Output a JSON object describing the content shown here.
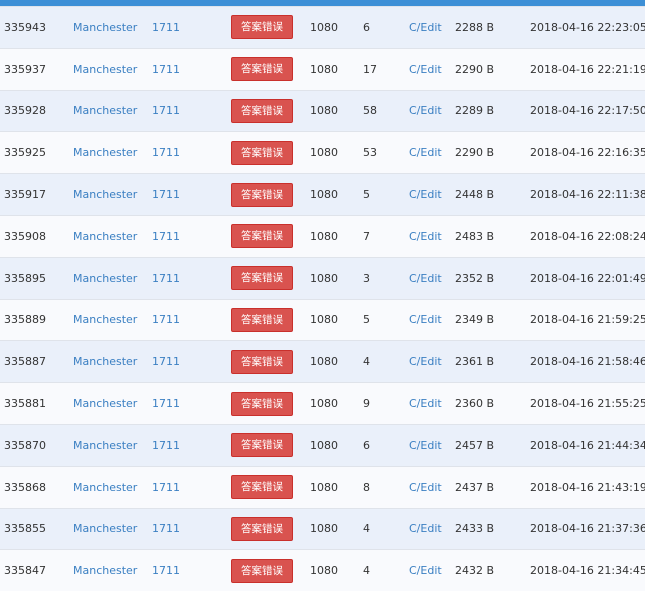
{
  "status_color": "#d9534f",
  "link_color": "#3a7fc2",
  "rows": [
    {
      "id": "335943",
      "user": "Manchester",
      "problem": "1711",
      "status": "答案错误",
      "memory": "1080",
      "time": "6",
      "lang": "C/Edit",
      "length": "2288 B",
      "submitted": "2018-04-16 22:23:05"
    },
    {
      "id": "335937",
      "user": "Manchester",
      "problem": "1711",
      "status": "答案错误",
      "memory": "1080",
      "time": "17",
      "lang": "C/Edit",
      "length": "2290 B",
      "submitted": "2018-04-16 22:21:19"
    },
    {
      "id": "335928",
      "user": "Manchester",
      "problem": "1711",
      "status": "答案错误",
      "memory": "1080",
      "time": "58",
      "lang": "C/Edit",
      "length": "2289 B",
      "submitted": "2018-04-16 22:17:50"
    },
    {
      "id": "335925",
      "user": "Manchester",
      "problem": "1711",
      "status": "答案错误",
      "memory": "1080",
      "time": "53",
      "lang": "C/Edit",
      "length": "2290 B",
      "submitted": "2018-04-16 22:16:35"
    },
    {
      "id": "335917",
      "user": "Manchester",
      "problem": "1711",
      "status": "答案错误",
      "memory": "1080",
      "time": "5",
      "lang": "C/Edit",
      "length": "2448 B",
      "submitted": "2018-04-16 22:11:38"
    },
    {
      "id": "335908",
      "user": "Manchester",
      "problem": "1711",
      "status": "答案错误",
      "memory": "1080",
      "time": "7",
      "lang": "C/Edit",
      "length": "2483 B",
      "submitted": "2018-04-16 22:08:24"
    },
    {
      "id": "335895",
      "user": "Manchester",
      "problem": "1711",
      "status": "答案错误",
      "memory": "1080",
      "time": "3",
      "lang": "C/Edit",
      "length": "2352 B",
      "submitted": "2018-04-16 22:01:49"
    },
    {
      "id": "335889",
      "user": "Manchester",
      "problem": "1711",
      "status": "答案错误",
      "memory": "1080",
      "time": "5",
      "lang": "C/Edit",
      "length": "2349 B",
      "submitted": "2018-04-16 21:59:25"
    },
    {
      "id": "335887",
      "user": "Manchester",
      "problem": "1711",
      "status": "答案错误",
      "memory": "1080",
      "time": "4",
      "lang": "C/Edit",
      "length": "2361 B",
      "submitted": "2018-04-16 21:58:46"
    },
    {
      "id": "335881",
      "user": "Manchester",
      "problem": "1711",
      "status": "答案错误",
      "memory": "1080",
      "time": "9",
      "lang": "C/Edit",
      "length": "2360 B",
      "submitted": "2018-04-16 21:55:25"
    },
    {
      "id": "335870",
      "user": "Manchester",
      "problem": "1711",
      "status": "答案错误",
      "memory": "1080",
      "time": "6",
      "lang": "C/Edit",
      "length": "2457 B",
      "submitted": "2018-04-16 21:44:34"
    },
    {
      "id": "335868",
      "user": "Manchester",
      "problem": "1711",
      "status": "答案错误",
      "memory": "1080",
      "time": "8",
      "lang": "C/Edit",
      "length": "2437 B",
      "submitted": "2018-04-16 21:43:19"
    },
    {
      "id": "335855",
      "user": "Manchester",
      "problem": "1711",
      "status": "答案错误",
      "memory": "1080",
      "time": "4",
      "lang": "C/Edit",
      "length": "2433 B",
      "submitted": "2018-04-16 21:37:36"
    },
    {
      "id": "335847",
      "user": "Manchester",
      "problem": "1711",
      "status": "答案错误",
      "memory": "1080",
      "time": "4",
      "lang": "C/Edit",
      "length": "2432 B",
      "submitted": "2018-04-16 21:34:45"
    }
  ]
}
